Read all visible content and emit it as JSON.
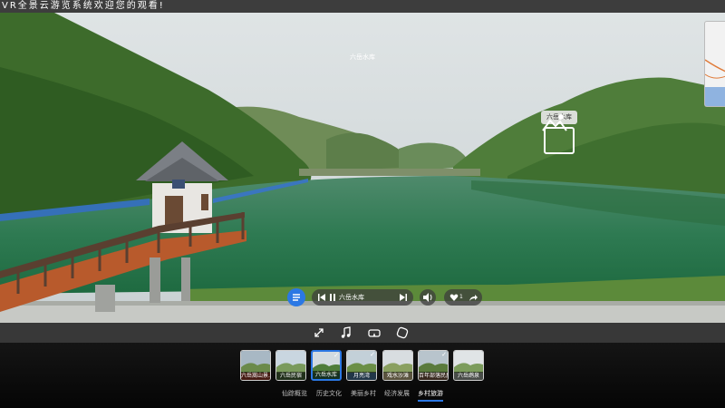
{
  "marquee": {
    "text": "VR全景云游览系统欢迎您的观看!"
  },
  "scene": {
    "title": "六岳水库"
  },
  "hotspot": {
    "label": "六岳水库",
    "icon": "landscape-picture-icon"
  },
  "controls": {
    "menu_icon": "menu-list-icon",
    "audio_track": "六岳水库",
    "prev_icon": "skip-previous-icon",
    "pause_icon": "pause-icon",
    "next_icon": "skip-next-icon",
    "volume_icon": "volume-icon",
    "like_count": "1",
    "like_icon": "heart-icon",
    "share_icon": "share-icon"
  },
  "toolbar": {
    "icons": [
      "fullscreen-icon",
      "music-icon",
      "vr-goggles-icon",
      "gyroscope-icon"
    ]
  },
  "scenes": [
    {
      "label": "六岳嵩山景...",
      "active": false,
      "checked": false
    },
    {
      "label": "六岳民宿",
      "active": false,
      "checked": false
    },
    {
      "label": "六岳水库",
      "active": true,
      "checked": true
    },
    {
      "label": "月亮湾",
      "active": false,
      "checked": true
    },
    {
      "label": "戏水沙滩",
      "active": false,
      "checked": false
    },
    {
      "label": "百年部落民居",
      "active": false,
      "checked": true
    },
    {
      "label": "六岳鹉泉",
      "active": false,
      "checked": false
    }
  ],
  "categories": [
    {
      "label": "仙踪概览",
      "active": false
    },
    {
      "label": "历史文化",
      "active": false
    },
    {
      "label": "美丽乡村",
      "active": false
    },
    {
      "label": "经济发展",
      "active": false
    },
    {
      "label": "乡村旅游",
      "active": true
    }
  ],
  "colors": {
    "accent": "#2b78e4",
    "toolbar": "#383838",
    "marquee": "#3d3d3d"
  }
}
